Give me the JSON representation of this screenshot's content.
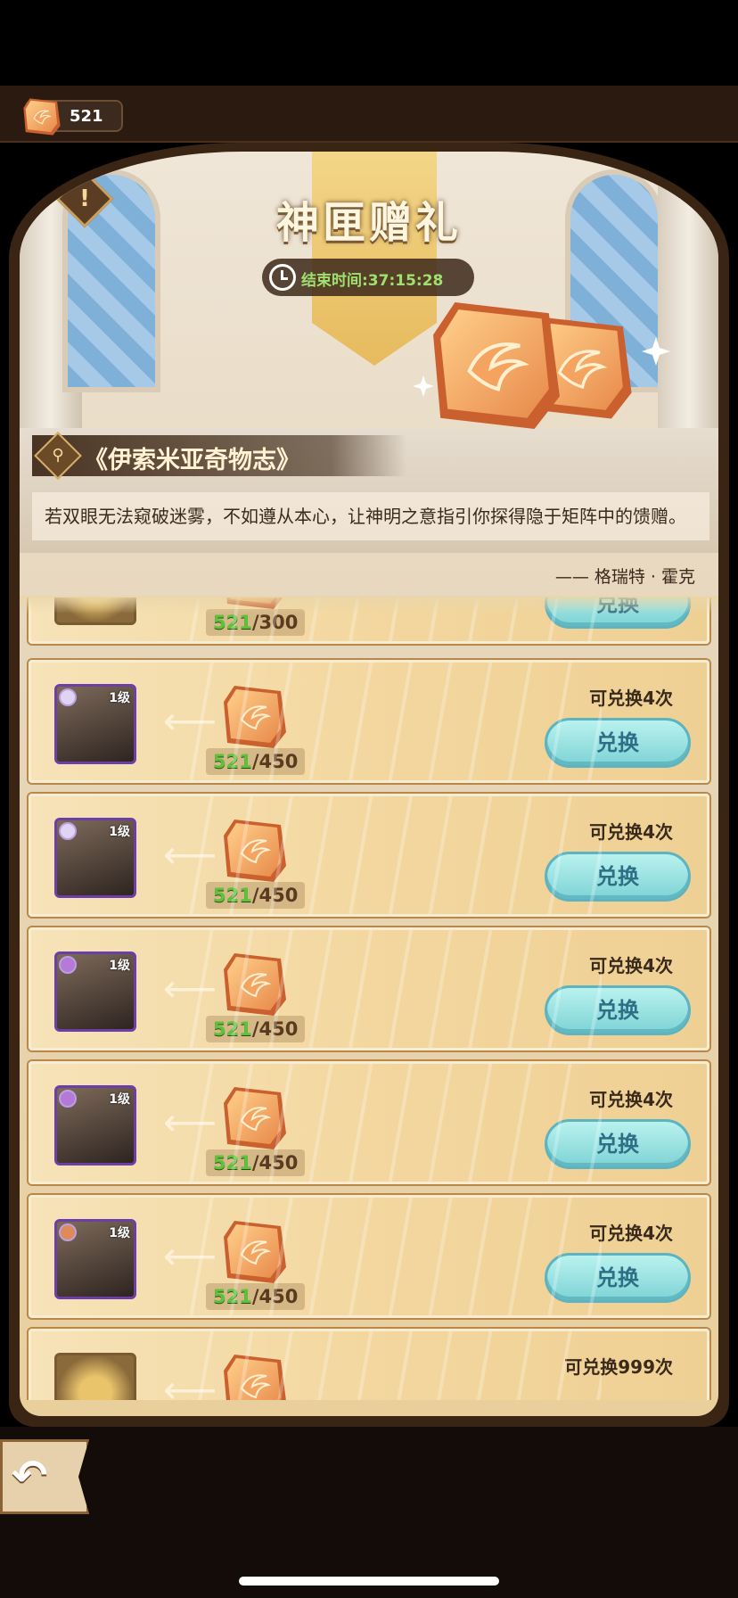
{
  "currency": {
    "amount": "521",
    "icon": "token-icon"
  },
  "header": {
    "title": "神匣赠礼",
    "timer_label": "结束时间:37:15:28",
    "info_label": "!"
  },
  "story": {
    "book_title": "《伊索米亚奇物志》",
    "text": "若双眼无法窥破迷雾，不如遵从本心，让神明之意指引你探得隐于矩阵中的馈赠。",
    "author": "—— 格瑞特 · 霍克",
    "search_icon": "magnifier-icon"
  },
  "rows": [
    {
      "have": "521",
      "need": "/300",
      "times": "",
      "button": "兑换",
      "level": ""
    },
    {
      "have": "521",
      "need": "/450",
      "times": "可兑换4次",
      "button": "兑换",
      "level": "1级"
    },
    {
      "have": "521",
      "need": "/450",
      "times": "可兑换4次",
      "button": "兑换",
      "level": "1级"
    },
    {
      "have": "521",
      "need": "/450",
      "times": "可兑换4次",
      "button": "兑换",
      "level": "1级"
    },
    {
      "have": "521",
      "need": "/450",
      "times": "可兑换4次",
      "button": "兑换",
      "level": "1级"
    },
    {
      "have": "521",
      "need": "/450",
      "times": "可兑换4次",
      "button": "兑换",
      "level": "1级"
    },
    {
      "have": "",
      "need": "",
      "times": "可兑换999次",
      "button": "",
      "level": ""
    }
  ],
  "colors": {
    "accent": "#7ed3d6",
    "have": "#5fc23a",
    "frame": "#3a2414"
  }
}
